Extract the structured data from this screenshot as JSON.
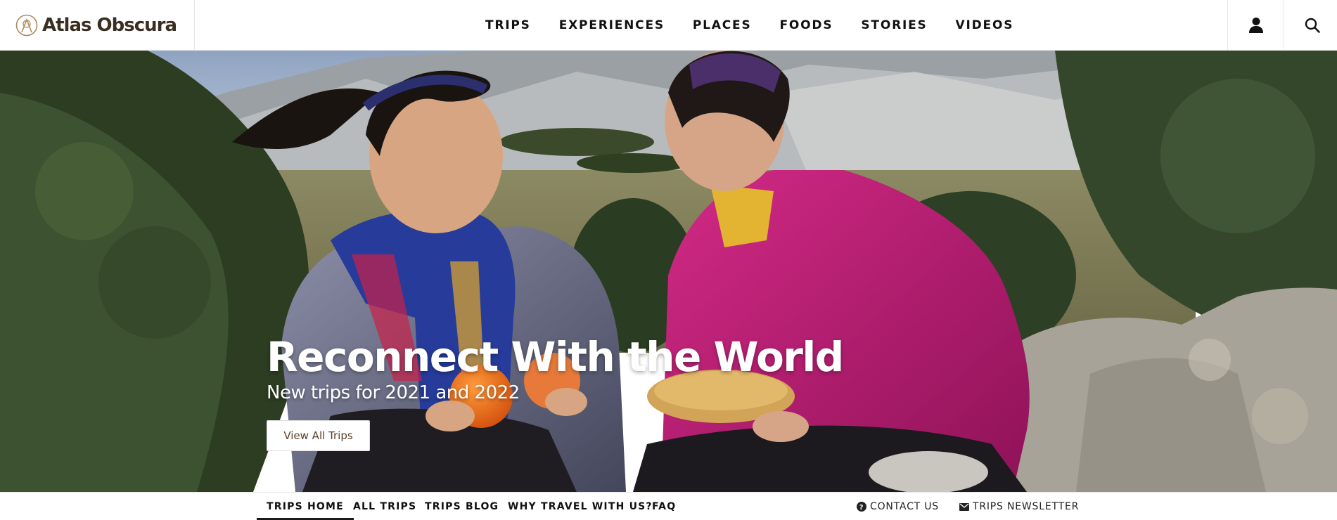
{
  "header": {
    "logo_text": "Atlas Obscura",
    "nav": [
      "TRIPS",
      "EXPERIENCES",
      "PLACES",
      "FOODS",
      "STORIES",
      "VIDEOS"
    ],
    "account_icon": "person-icon",
    "search_icon": "search-icon"
  },
  "hero": {
    "title": "Reconnect With the World",
    "subtitle": "New trips for 2021 and 2022",
    "button_label": "View All Trips"
  },
  "subnav": {
    "items": [
      "TRIPS HOME",
      "ALL TRIPS",
      "TRIPS BLOG",
      "WHY TRAVEL WITH US?",
      "FAQ"
    ],
    "active_index": 0,
    "contact_label": "CONTACT US",
    "contact_icon": "question-circle-icon",
    "newsletter_label": "TRIPS NEWSLETTER",
    "newsletter_icon": "envelope-icon"
  },
  "colors": {
    "logo": "#3a2e22",
    "nav_text": "#111111",
    "button_text": "#5a3e2b"
  }
}
